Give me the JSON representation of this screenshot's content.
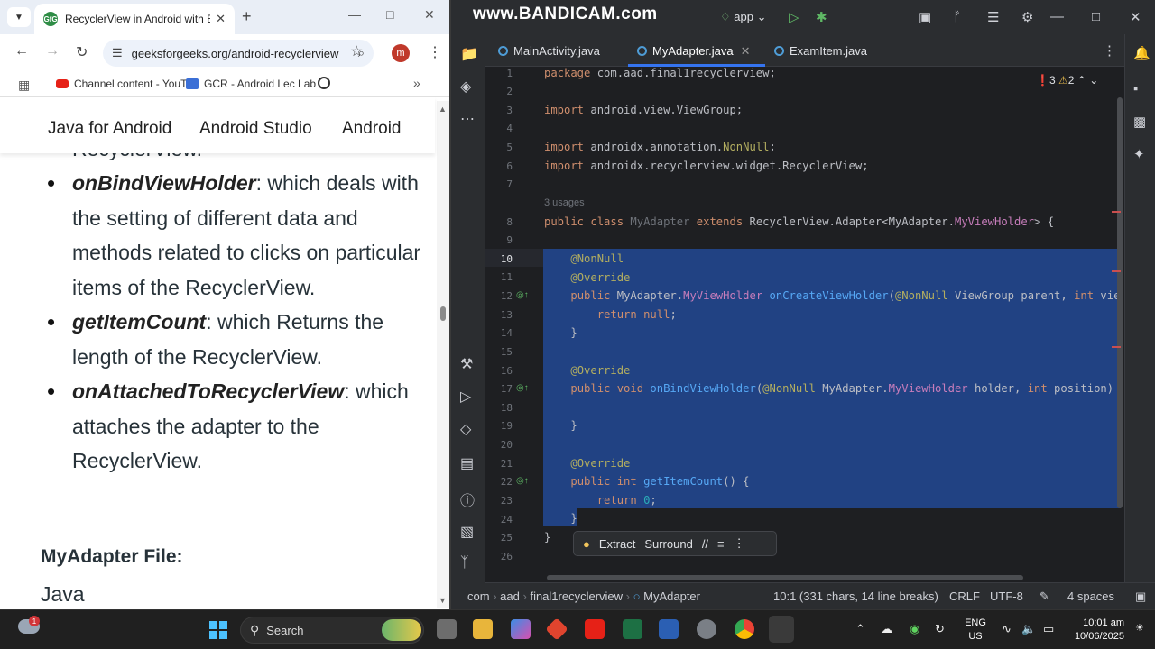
{
  "browser": {
    "tab_title": "RecyclerView in Android with Example",
    "tab_favicon": "GfG",
    "url": "geeksforgeeks.org/android-recyclerview",
    "profile_initial": "m",
    "bookmarks": [
      {
        "label": "Channel content - YouTube Studio",
        "icon": "youtube-icon"
      },
      {
        "label": "GCR - Android Lec Lab",
        "icon": "classroom-icon"
      }
    ],
    "nav_links": [
      "Java for Android",
      "Android Studio",
      "Android"
    ],
    "article": {
      "cut_text": "RecyclerView.",
      "bullets": [
        {
          "term": "onBindViewHolder",
          "desc": ": which deals with the setting of different data and methods related to clicks on particular items of the RecyclerView."
        },
        {
          "term": "getItemCount",
          "desc": ": which Returns the length of the RecyclerView."
        },
        {
          "term": "onAttachedToRecyclerView",
          "desc": ": which attaches the adapter to the RecyclerView."
        }
      ],
      "subheading": "MyAdapter File:",
      "language": "Java"
    }
  },
  "ide": {
    "watermark": "www.BANDICAM.com",
    "run_config": "app",
    "tabs": [
      {
        "label": "MainActivity.java",
        "active": false
      },
      {
        "label": "MyAdapter.java",
        "active": true
      },
      {
        "label": "ExamItem.java",
        "active": false
      }
    ],
    "inspections": {
      "errors": "3",
      "warnings": "2"
    },
    "usages_hint": "3 usages",
    "current_line": "10",
    "popup": {
      "extract": "Extract",
      "surround": "Surround"
    },
    "status": {
      "breadcrumb": [
        "com",
        "aad",
        "final1recyclerview",
        "MyAdapter"
      ],
      "position": "10:1 (331 chars, 14 line breaks)",
      "line_ending": "CRLF",
      "encoding": "UTF-8",
      "indent": "4 spaces"
    },
    "colors": {
      "selection": "#214283",
      "keyword": "#cf8e6d",
      "annotation": "#b3ae60",
      "function": "#56a8f5",
      "error": "#e55353"
    }
  },
  "taskbar": {
    "notification_count": "1",
    "search_placeholder": "Search",
    "language": "ENG",
    "region": "US",
    "time": "10:01 am",
    "date": "10/06/2025"
  }
}
